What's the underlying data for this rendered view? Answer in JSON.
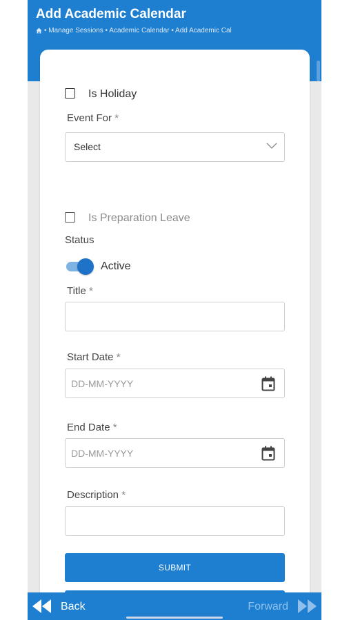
{
  "header": {
    "title": "Add Academic Calendar",
    "breadcrumb": "• Manage Sessions • Academic Calendar • Add Academic Cal"
  },
  "form": {
    "is_holiday_label": "Is Holiday",
    "event_for_label": "Event For",
    "event_for_value": "Select",
    "is_preparation_leave_label": "Is Preparation Leave",
    "status_label": "Status",
    "status_value": "Active",
    "title_label": "Title",
    "start_date_label": "Start Date",
    "start_date_placeholder": "DD-MM-YYYY",
    "end_date_label": "End Date",
    "end_date_placeholder": "DD-MM-YYYY",
    "description_label": "Description",
    "required_marker": "*",
    "submit_label": "SUBMIT"
  },
  "nav": {
    "back_label": "Back",
    "forward_label": "Forward"
  },
  "colors": {
    "primary": "#1e7fd0",
    "toggle_on": "#1e73c8"
  },
  "icons": [
    "home-icon",
    "chevron-down-icon",
    "calendar-icon",
    "double-arrow-left-icon",
    "double-arrow-right-icon"
  ]
}
